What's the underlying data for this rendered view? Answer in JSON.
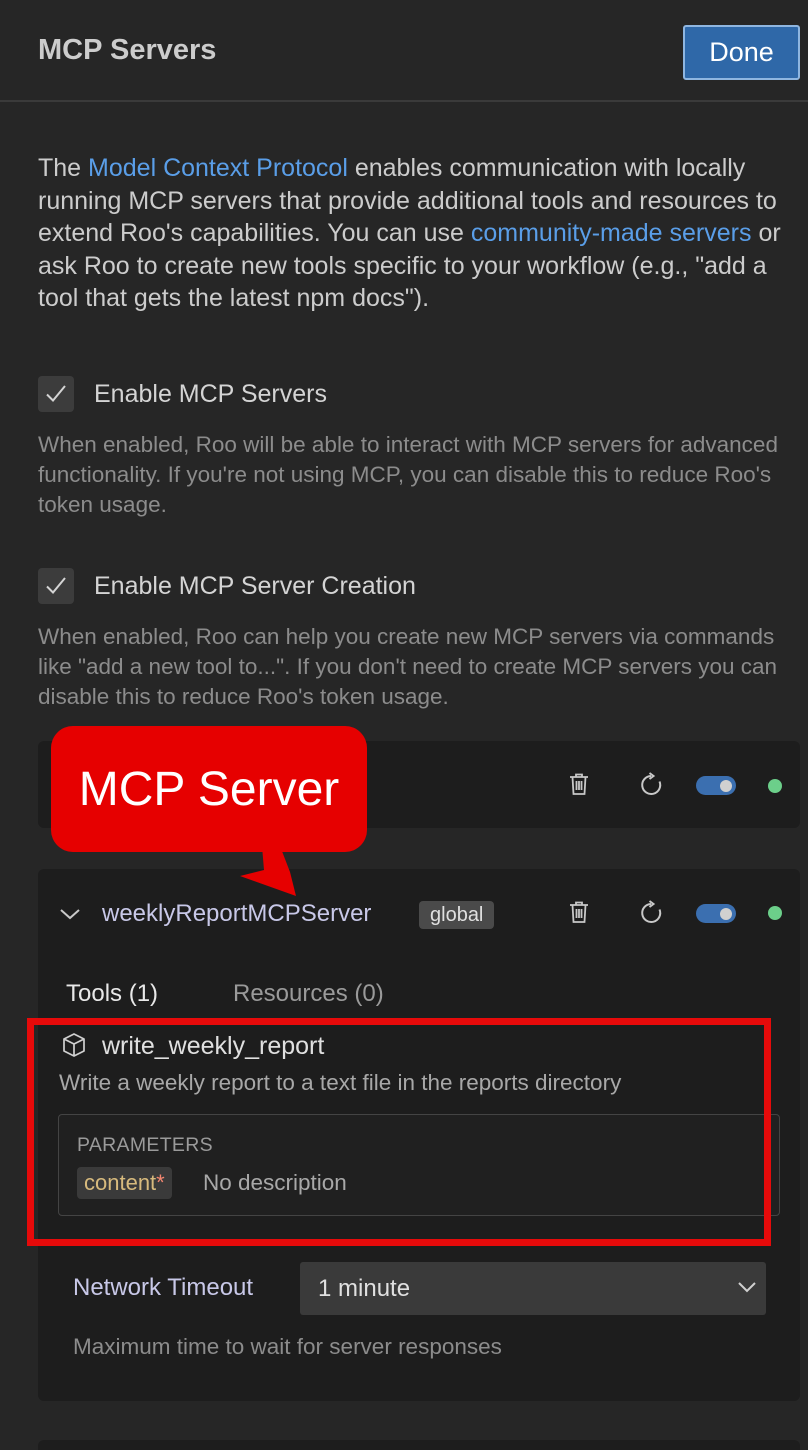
{
  "header": {
    "title": "MCP Servers",
    "done_label": "Done"
  },
  "intro": {
    "text_1": "The ",
    "link_1": "Model Context Protocol",
    "text_2": " enables communication with locally running MCP servers that provide additional tools and resources to extend Roo's capabilities. You can use ",
    "link_2": "community-made servers",
    "text_3": " or ask Roo to create new tools specific to your workflow (e.g., \"add a tool that gets the latest npm docs\")."
  },
  "settings": {
    "enable_servers": {
      "checked": true,
      "label": "Enable MCP Servers",
      "description": "When enabled, Roo will be able to interact with MCP servers for advanced functionality. If you're not using MCP, you can disable this to reduce Roo's token usage."
    },
    "enable_creation": {
      "checked": true,
      "label": "Enable MCP Server Creation",
      "description": "When enabled, Roo can help you create new MCP servers via commands like \"add a new tool to...\". If you don't need to create MCP servers you can disable this to reduce Roo's token usage."
    }
  },
  "annotation": {
    "callout_text": "MCP Server"
  },
  "server": {
    "name": "weeklyReportMCPServer",
    "scope": "global",
    "enabled": true,
    "status_color": "#6ccf8a",
    "tabs": [
      {
        "label": "Tools (1)",
        "active": true
      },
      {
        "label": "Resources (0)",
        "active": false
      }
    ],
    "tool": {
      "name": "write_weekly_report",
      "description": "Write a weekly report to a text file in the reports directory",
      "params_title": "PARAMETERS",
      "param_name": "content",
      "param_required_mark": "*",
      "param_description": "No description"
    },
    "network_timeout": {
      "label": "Network Timeout",
      "value": "1 minute",
      "hint": "Maximum time to wait for server responses"
    }
  },
  "colors": {
    "accent": "#2f68a8",
    "link": "#5a9ee8",
    "annotation_red": "#e60000"
  }
}
